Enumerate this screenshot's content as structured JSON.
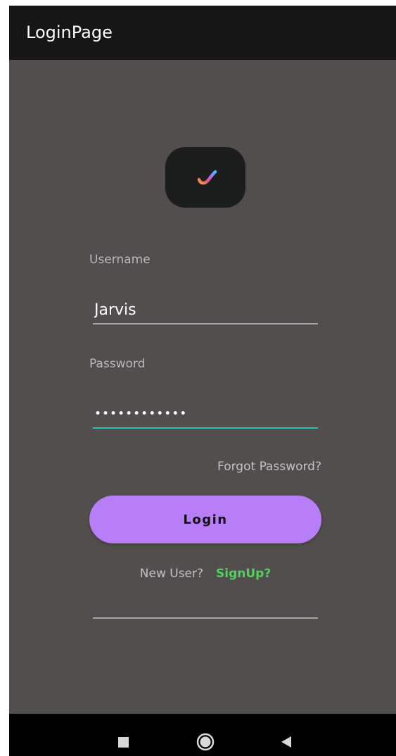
{
  "app_bar": {
    "title": "LoginPage"
  },
  "logo": {
    "icon": "check-swoosh-icon",
    "colors": [
      "#f0a23a",
      "#e2547e",
      "#a875ff",
      "#3fb9ff"
    ]
  },
  "form": {
    "username_label": "Username",
    "username_value": "Jarvis",
    "password_label": "Password",
    "password_value": "••••••••••••",
    "forgot_label": "Forgot Password?",
    "login_label": "Login",
    "new_user_label": "New User?",
    "signup_label": "SignUp?"
  },
  "colors": {
    "background": "#524e4e",
    "app_bar": "#161616",
    "accent_button": "#b77ef8",
    "focus_underline": "#2ac1b9",
    "signup_link": "#4ed45a"
  },
  "nav": {
    "recents_icon": "square-icon",
    "home_icon": "circle-icon",
    "back_icon": "triangle-back-icon"
  }
}
